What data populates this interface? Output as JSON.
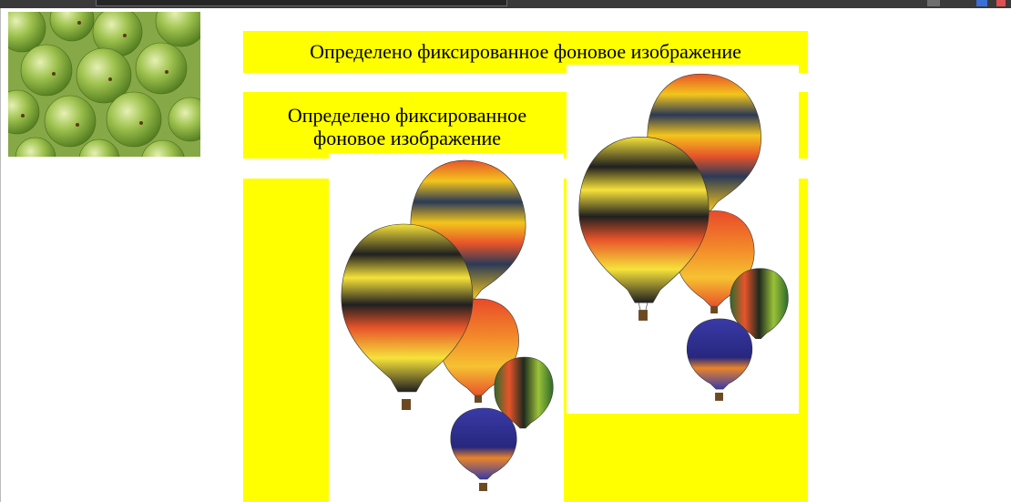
{
  "page": {
    "caption_top": "Определено фиксированное фоновое изображение",
    "caption_middle": "Определено фиксированное фоновое изображение"
  },
  "colors": {
    "box_background": "#ffff00",
    "page_background": "#ffffff",
    "text": "#000000"
  },
  "images": {
    "apples": "green-apples-background",
    "balloons": "hot-air-balloons-background"
  }
}
